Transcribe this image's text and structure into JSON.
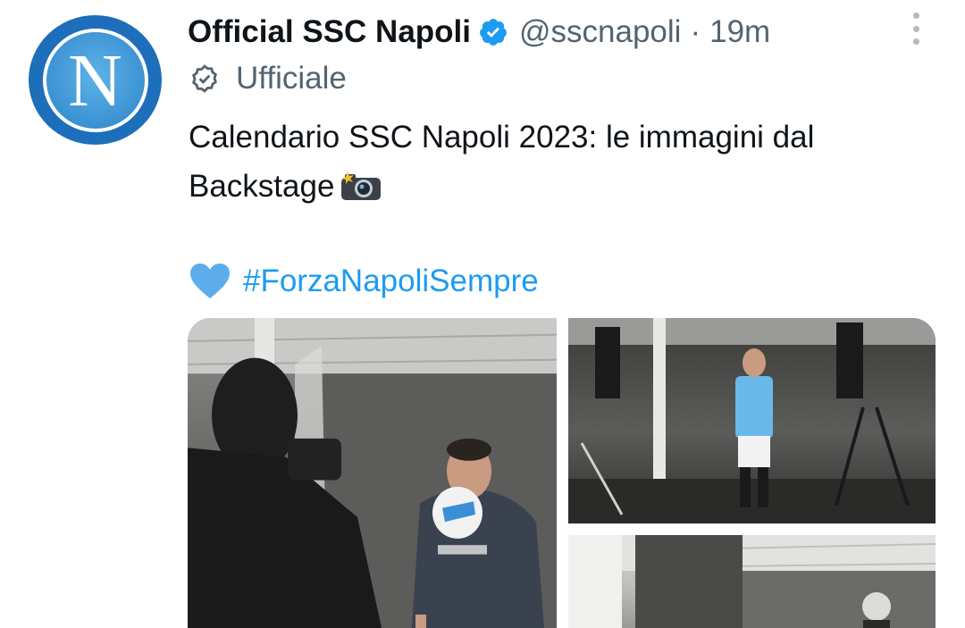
{
  "tweet": {
    "display_name": "Official SSC Napoli",
    "handle": "@sscnapoli",
    "separator": "·",
    "time": "19m",
    "label": "Ufficiale",
    "text_line1": "Calendario SSC Napoli 2023: le immagini dal",
    "text_line2": "Backstage",
    "hashtag": "#ForzaNapoliSempre",
    "avatar_letter": "N"
  },
  "colors": {
    "avatar_blue": "#1d6fbb",
    "verified_blue": "#1d9bf0",
    "hashtag_blue": "#1d9bf0",
    "secondary_text": "#536471",
    "heart_blue": "#5dadec"
  },
  "icons": {
    "verified": "verified-badge-icon",
    "label": "official-label-icon",
    "more": "more-options-icon",
    "camera": "camera-flash-emoji",
    "heart": "blue-heart-emoji"
  }
}
